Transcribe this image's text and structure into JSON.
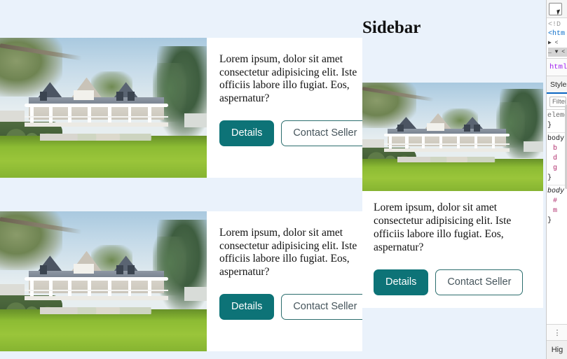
{
  "page": {
    "background_color": "#eaf2fb",
    "card_background": "#ffffff",
    "accent_color": "#0d7377"
  },
  "main": {
    "cards": [
      {
        "image_alt": "white-house-with-porch-photo",
        "text": "Lorem ipsum, dolor sit amet consectetur adipisicing elit. Iste officiis labore illo fugiat. Eos, aspernatur?",
        "primary_button": "Details",
        "secondary_button": "Contact Seller"
      },
      {
        "image_alt": "white-house-with-porch-photo",
        "text": "Lorem ipsum, dolor sit amet consectetur adipisicing elit. Iste officiis labore illo fugiat. Eos, aspernatur?",
        "primary_button": "Details",
        "secondary_button": "Contact Seller"
      }
    ]
  },
  "sidebar": {
    "title": "Sidebar",
    "card": {
      "image_alt": "white-house-with-porch-photo",
      "text": "Lorem ipsum, dolor sit amet consectetur adipisicing elit. Iste officiis labore illo fugiat. Eos, aspernatur?",
      "primary_button": "Details",
      "secondary_button": "Contact Seller"
    }
  },
  "devtools": {
    "picker_icon": "element-picker-icon",
    "markup": [
      "<!D",
      "<htm",
      "▶ <",
      "… ▼ <"
    ],
    "breadcrumb": "html",
    "tab": "Styles",
    "filter_placeholder": "Filter",
    "rules": [
      "element",
      "}",
      "body",
      "b",
      "d",
      "g",
      "}",
      "body",
      "#",
      "m",
      "}"
    ],
    "grip_icon": "drag-handle-icon",
    "highlight_button": "Hig"
  }
}
